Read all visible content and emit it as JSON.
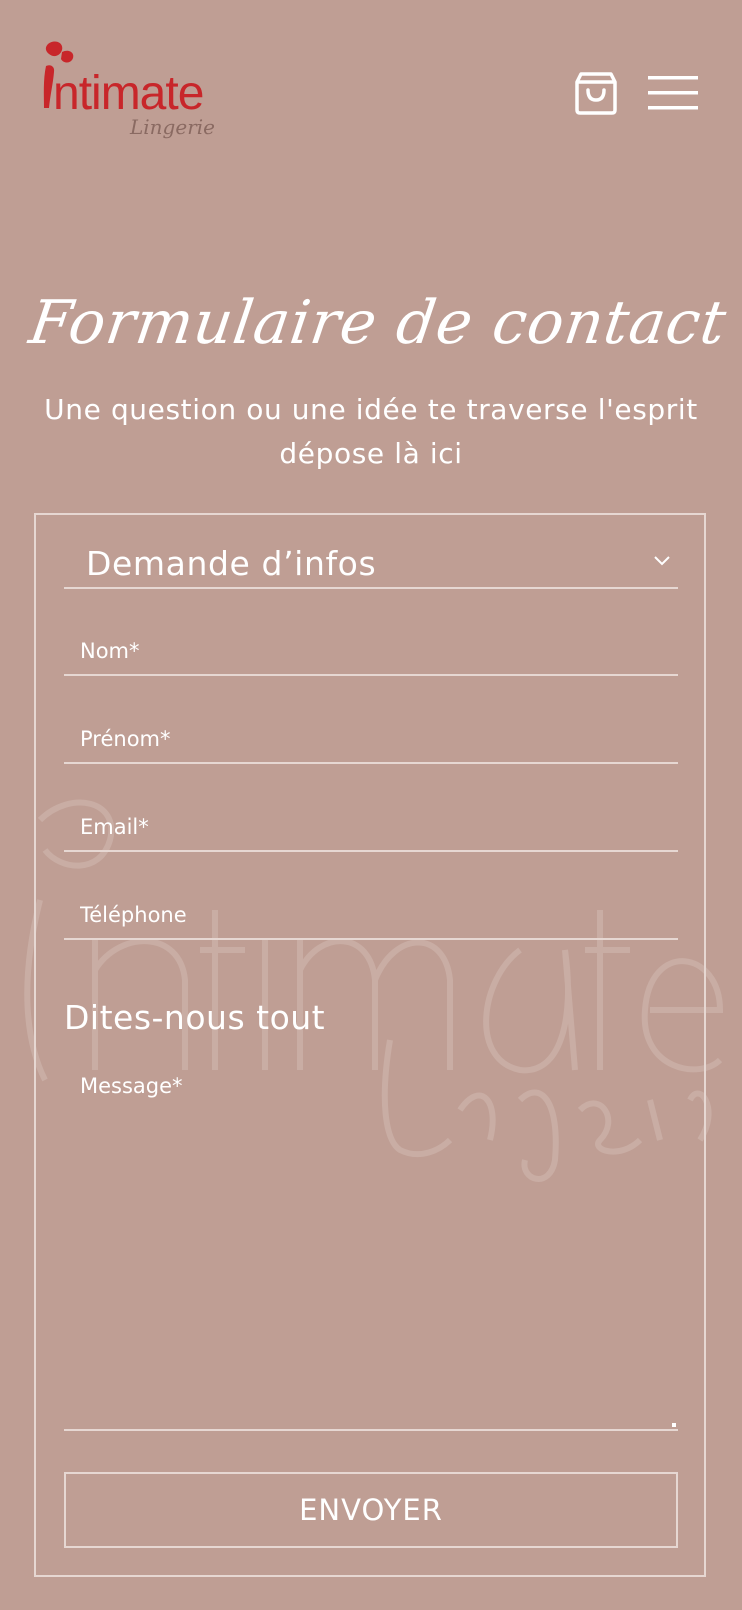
{
  "brand": {
    "logo_text": "ntimate",
    "logo_subtext": "Lingerie",
    "logo_color": "#c8262a"
  },
  "header": {
    "cart_icon": "shopping-bag-icon",
    "menu_icon": "hamburger-menu-icon"
  },
  "page": {
    "title": "Formulaire de contact",
    "subtitle": "Une question ou une idée te traverse l'esprit dépose là ici"
  },
  "form": {
    "subject_select": {
      "value": "Demande d’infos",
      "icon": "chevron-down-icon"
    },
    "fields": {
      "nom": {
        "placeholder": "Nom*"
      },
      "prenom": {
        "placeholder": "Prénom*"
      },
      "email": {
        "placeholder": "Email*"
      },
      "telephone": {
        "placeholder": "Téléphone"
      }
    },
    "section_label": "Dites-nous tout",
    "message": {
      "placeholder": "Message*"
    },
    "submit_label": "ENVOYER"
  },
  "colors": {
    "background": "#bf9e94",
    "text": "#ffffff",
    "border": "#e6d7d2",
    "watermark": "#c7aaa1"
  }
}
